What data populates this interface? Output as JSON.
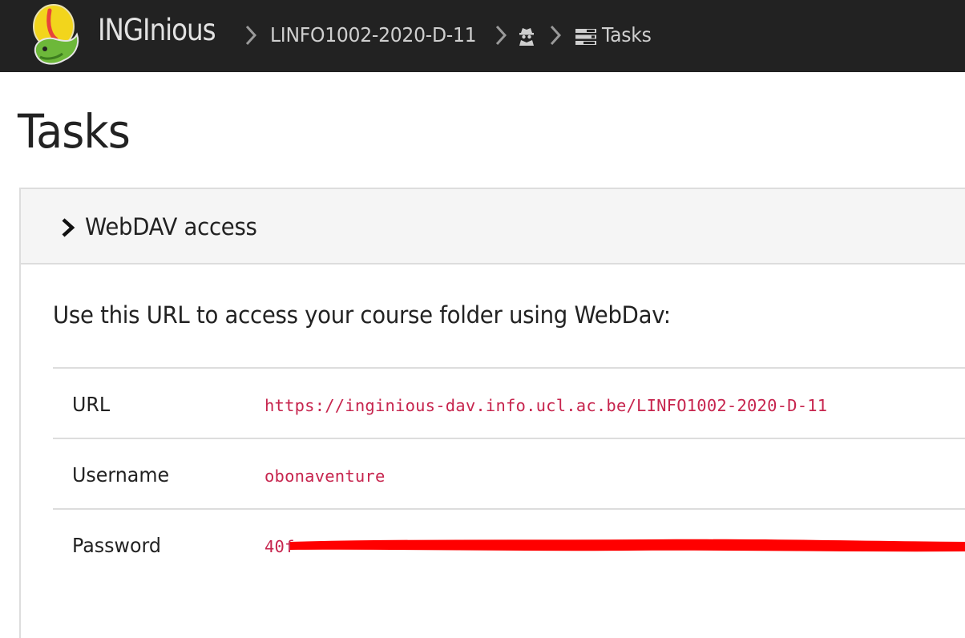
{
  "navbar": {
    "brand": "INGInious",
    "breadcrumb": [
      {
        "label": "LINFO1002-2020-D-11"
      },
      {
        "label": "",
        "icon": "user-secret-icon"
      },
      {
        "label": "Tasks",
        "icon": "tasks-icon"
      }
    ]
  },
  "page": {
    "title": "Tasks"
  },
  "webdav_panel": {
    "title": "WebDAV access",
    "intro": "Use this URL to access your course folder using WebDav:",
    "rows": [
      {
        "label": "URL",
        "value": "https://inginious-dav.info.ucl.ac.be/LINFO1002-2020-D-11"
      },
      {
        "label": "Username",
        "value": "obonaventure"
      },
      {
        "label": "Password",
        "value": "40f",
        "redacted": true
      }
    ]
  },
  "colors": {
    "navbar_bg": "#222222",
    "code_text": "#c7254e",
    "redaction": "#ff0000"
  }
}
